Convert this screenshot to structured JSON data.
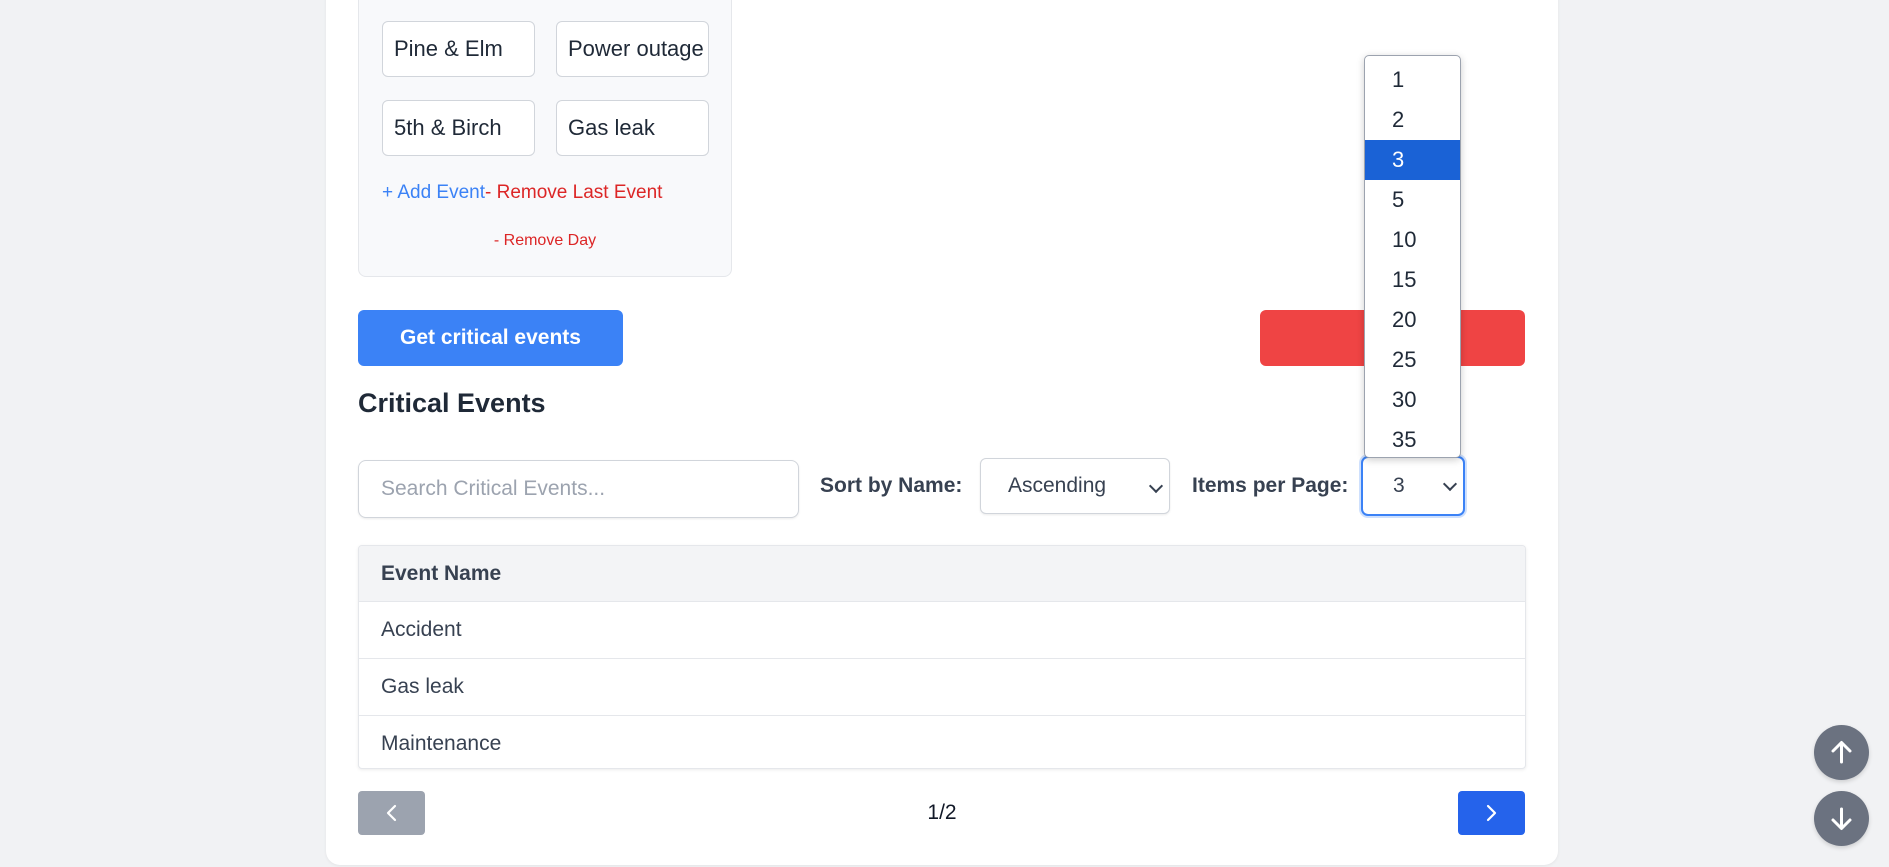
{
  "day_panel": {
    "events": [
      {
        "location": "Pine & Elm",
        "description": "Power outage"
      },
      {
        "location": "5th & Birch",
        "description": "Gas leak"
      }
    ],
    "add_event_label": "+ Add Event",
    "remove_last_event_label": "- Remove Last Event",
    "remove_day_label": "- Remove Day"
  },
  "actions": {
    "get_critical_label": "Get critical events"
  },
  "critical_events": {
    "title": "Critical Events",
    "search_placeholder": "Search Critical Events...",
    "sort_label": "Sort by Name:",
    "sort_value": "Ascending",
    "items_per_page_label": "Items per Page:",
    "items_per_page_value": "3",
    "items_per_page_options": [
      "1",
      "2",
      "3",
      "5",
      "10",
      "15",
      "20",
      "25",
      "30",
      "35"
    ],
    "table_header": "Event Name",
    "rows": [
      "Accident",
      "Gas leak",
      "Maintenance"
    ],
    "page_indicator": "1/2"
  },
  "colors": {
    "primary": "#3b82f6",
    "danger": "#ef4444",
    "selected_option": "#1a62d6"
  },
  "icons": {
    "prev": "chevron-left-icon",
    "next": "chevron-right-icon",
    "scroll_up": "arrow-up-icon",
    "scroll_down": "arrow-down-icon"
  }
}
